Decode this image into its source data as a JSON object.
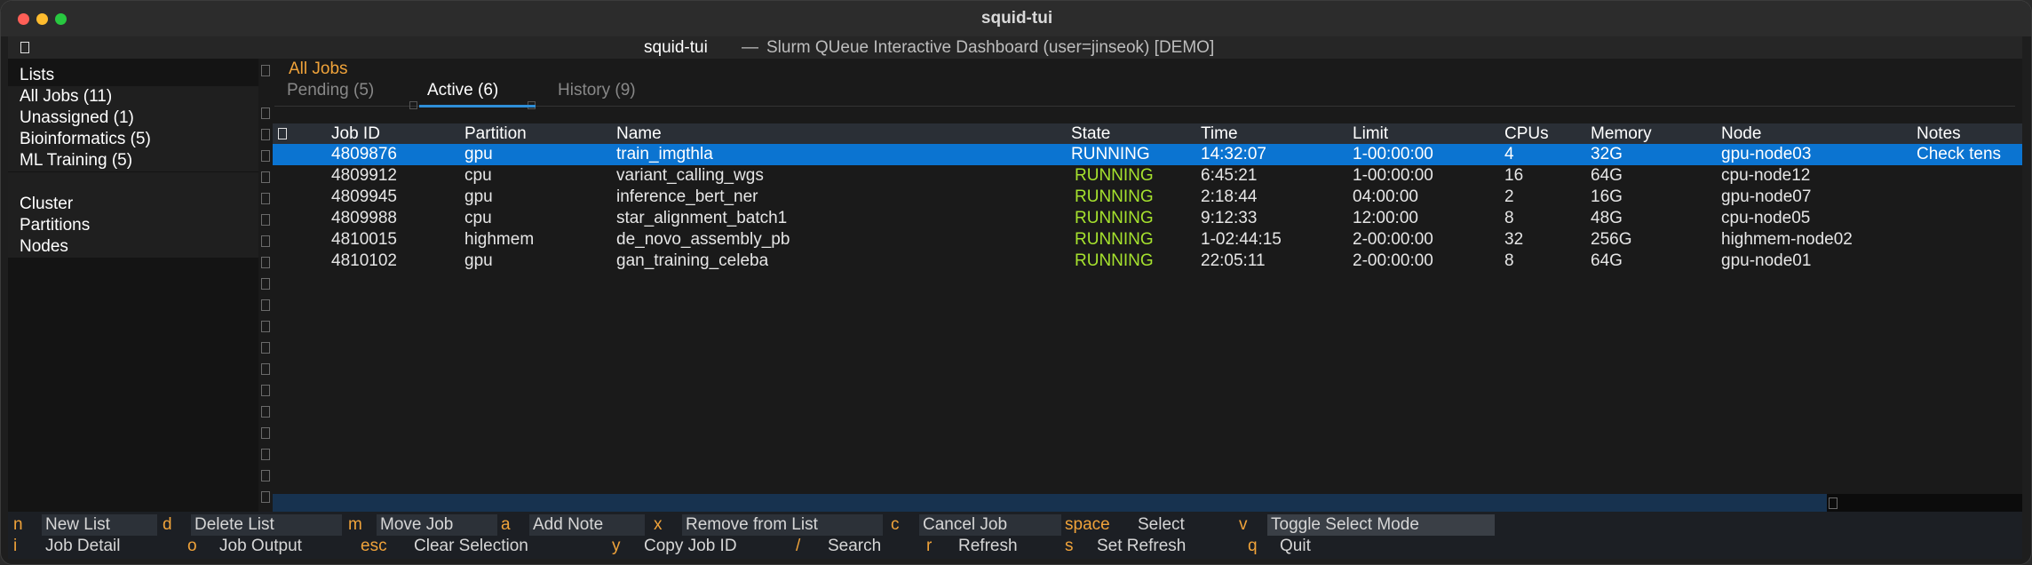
{
  "window": {
    "title": "squid-tui"
  },
  "header": {
    "app_name": "squid-tui",
    "separator": "—",
    "description": "Slurm QUeue Interactive Dashboard (user=jinseok) [DEMO]"
  },
  "sidebar": {
    "lists_heading": "Lists",
    "lists": [
      {
        "label": "All Jobs (11)"
      },
      {
        "label": "Unassigned (1)"
      },
      {
        "label": "Bioinformatics (5)"
      },
      {
        "label": "ML Training (5)"
      }
    ],
    "cluster_heading": "Cluster",
    "cluster_items": [
      {
        "label": "Partitions"
      },
      {
        "label": "Nodes"
      }
    ]
  },
  "main": {
    "title": "All Jobs",
    "tabs": [
      {
        "label": "Pending (5)",
        "active": false
      },
      {
        "label": "Active (6)",
        "active": true
      },
      {
        "label": "History (9)",
        "active": false
      }
    ]
  },
  "table": {
    "columns": [
      "Job ID",
      "Partition",
      "Name",
      "State",
      "Time",
      "Limit",
      "CPUs",
      "Memory",
      "Node",
      "Notes"
    ],
    "rows": [
      {
        "job_id": "4809876",
        "partition": "gpu",
        "name": "train_imgthla",
        "state": "RUNNING",
        "time": "14:32:07",
        "limit": "1-00:00:00",
        "cpus": "4",
        "memory": "32G",
        "node": "gpu-node03",
        "notes": "Check tens",
        "selected": true
      },
      {
        "job_id": "4809912",
        "partition": "cpu",
        "name": "variant_calling_wgs",
        "state": "RUNNING",
        "time": "6:45:21",
        "limit": "1-00:00:00",
        "cpus": "16",
        "memory": "64G",
        "node": "cpu-node12",
        "notes": "",
        "selected": false
      },
      {
        "job_id": "4809945",
        "partition": "gpu",
        "name": "inference_bert_ner",
        "state": "RUNNING",
        "time": "2:18:44",
        "limit": "04:00:00",
        "cpus": "2",
        "memory": "16G",
        "node": "gpu-node07",
        "notes": "",
        "selected": false
      },
      {
        "job_id": "4809988",
        "partition": "cpu",
        "name": "star_alignment_batch1",
        "state": "RUNNING",
        "time": "9:12:33",
        "limit": "12:00:00",
        "cpus": "8",
        "memory": "48G",
        "node": "cpu-node05",
        "notes": "",
        "selected": false
      },
      {
        "job_id": "4810015",
        "partition": "highmem",
        "name": "de_novo_assembly_pb",
        "state": "RUNNING",
        "time": "1-02:44:15",
        "limit": "2-00:00:00",
        "cpus": "32",
        "memory": "256G",
        "node": "highmem-node02",
        "notes": "",
        "selected": false
      },
      {
        "job_id": "4810102",
        "partition": "gpu",
        "name": "gan_training_celeba",
        "state": "RUNNING",
        "time": "22:05:11",
        "limit": "2-00:00:00",
        "cpus": "8",
        "memory": "64G",
        "node": "gpu-node01",
        "notes": "",
        "selected": false
      }
    ]
  },
  "footer": {
    "row1": [
      {
        "key": "n",
        "label": "New List"
      },
      {
        "key": "d",
        "label": "Delete List"
      },
      {
        "key": "m",
        "label": "Move Job"
      },
      {
        "key": "a",
        "label": "Add Note"
      },
      {
        "key": "x",
        "label": "Remove from List"
      },
      {
        "key": "c",
        "label": "Cancel Job"
      },
      {
        "key": "space",
        "label": "Select"
      },
      {
        "key": "v",
        "label": "Toggle Select Mode"
      }
    ],
    "row2": [
      {
        "key": "i",
        "label": "Job Detail"
      },
      {
        "key": "o",
        "label": "Job Output"
      },
      {
        "key": "esc",
        "label": "Clear Selection"
      },
      {
        "key": "y",
        "label": "Copy Job ID"
      },
      {
        "key": "/",
        "label": "Search"
      },
      {
        "key": "r",
        "label": "Refresh"
      },
      {
        "key": "s",
        "label": "Set Refresh"
      },
      {
        "key": "q",
        "label": "Quit"
      }
    ]
  },
  "colors": {
    "accent_orange": "#f0a33a",
    "running_green": "#a6e22e",
    "selection_blue": "#0b74d1",
    "tab_underline": "#2f8fd8"
  }
}
